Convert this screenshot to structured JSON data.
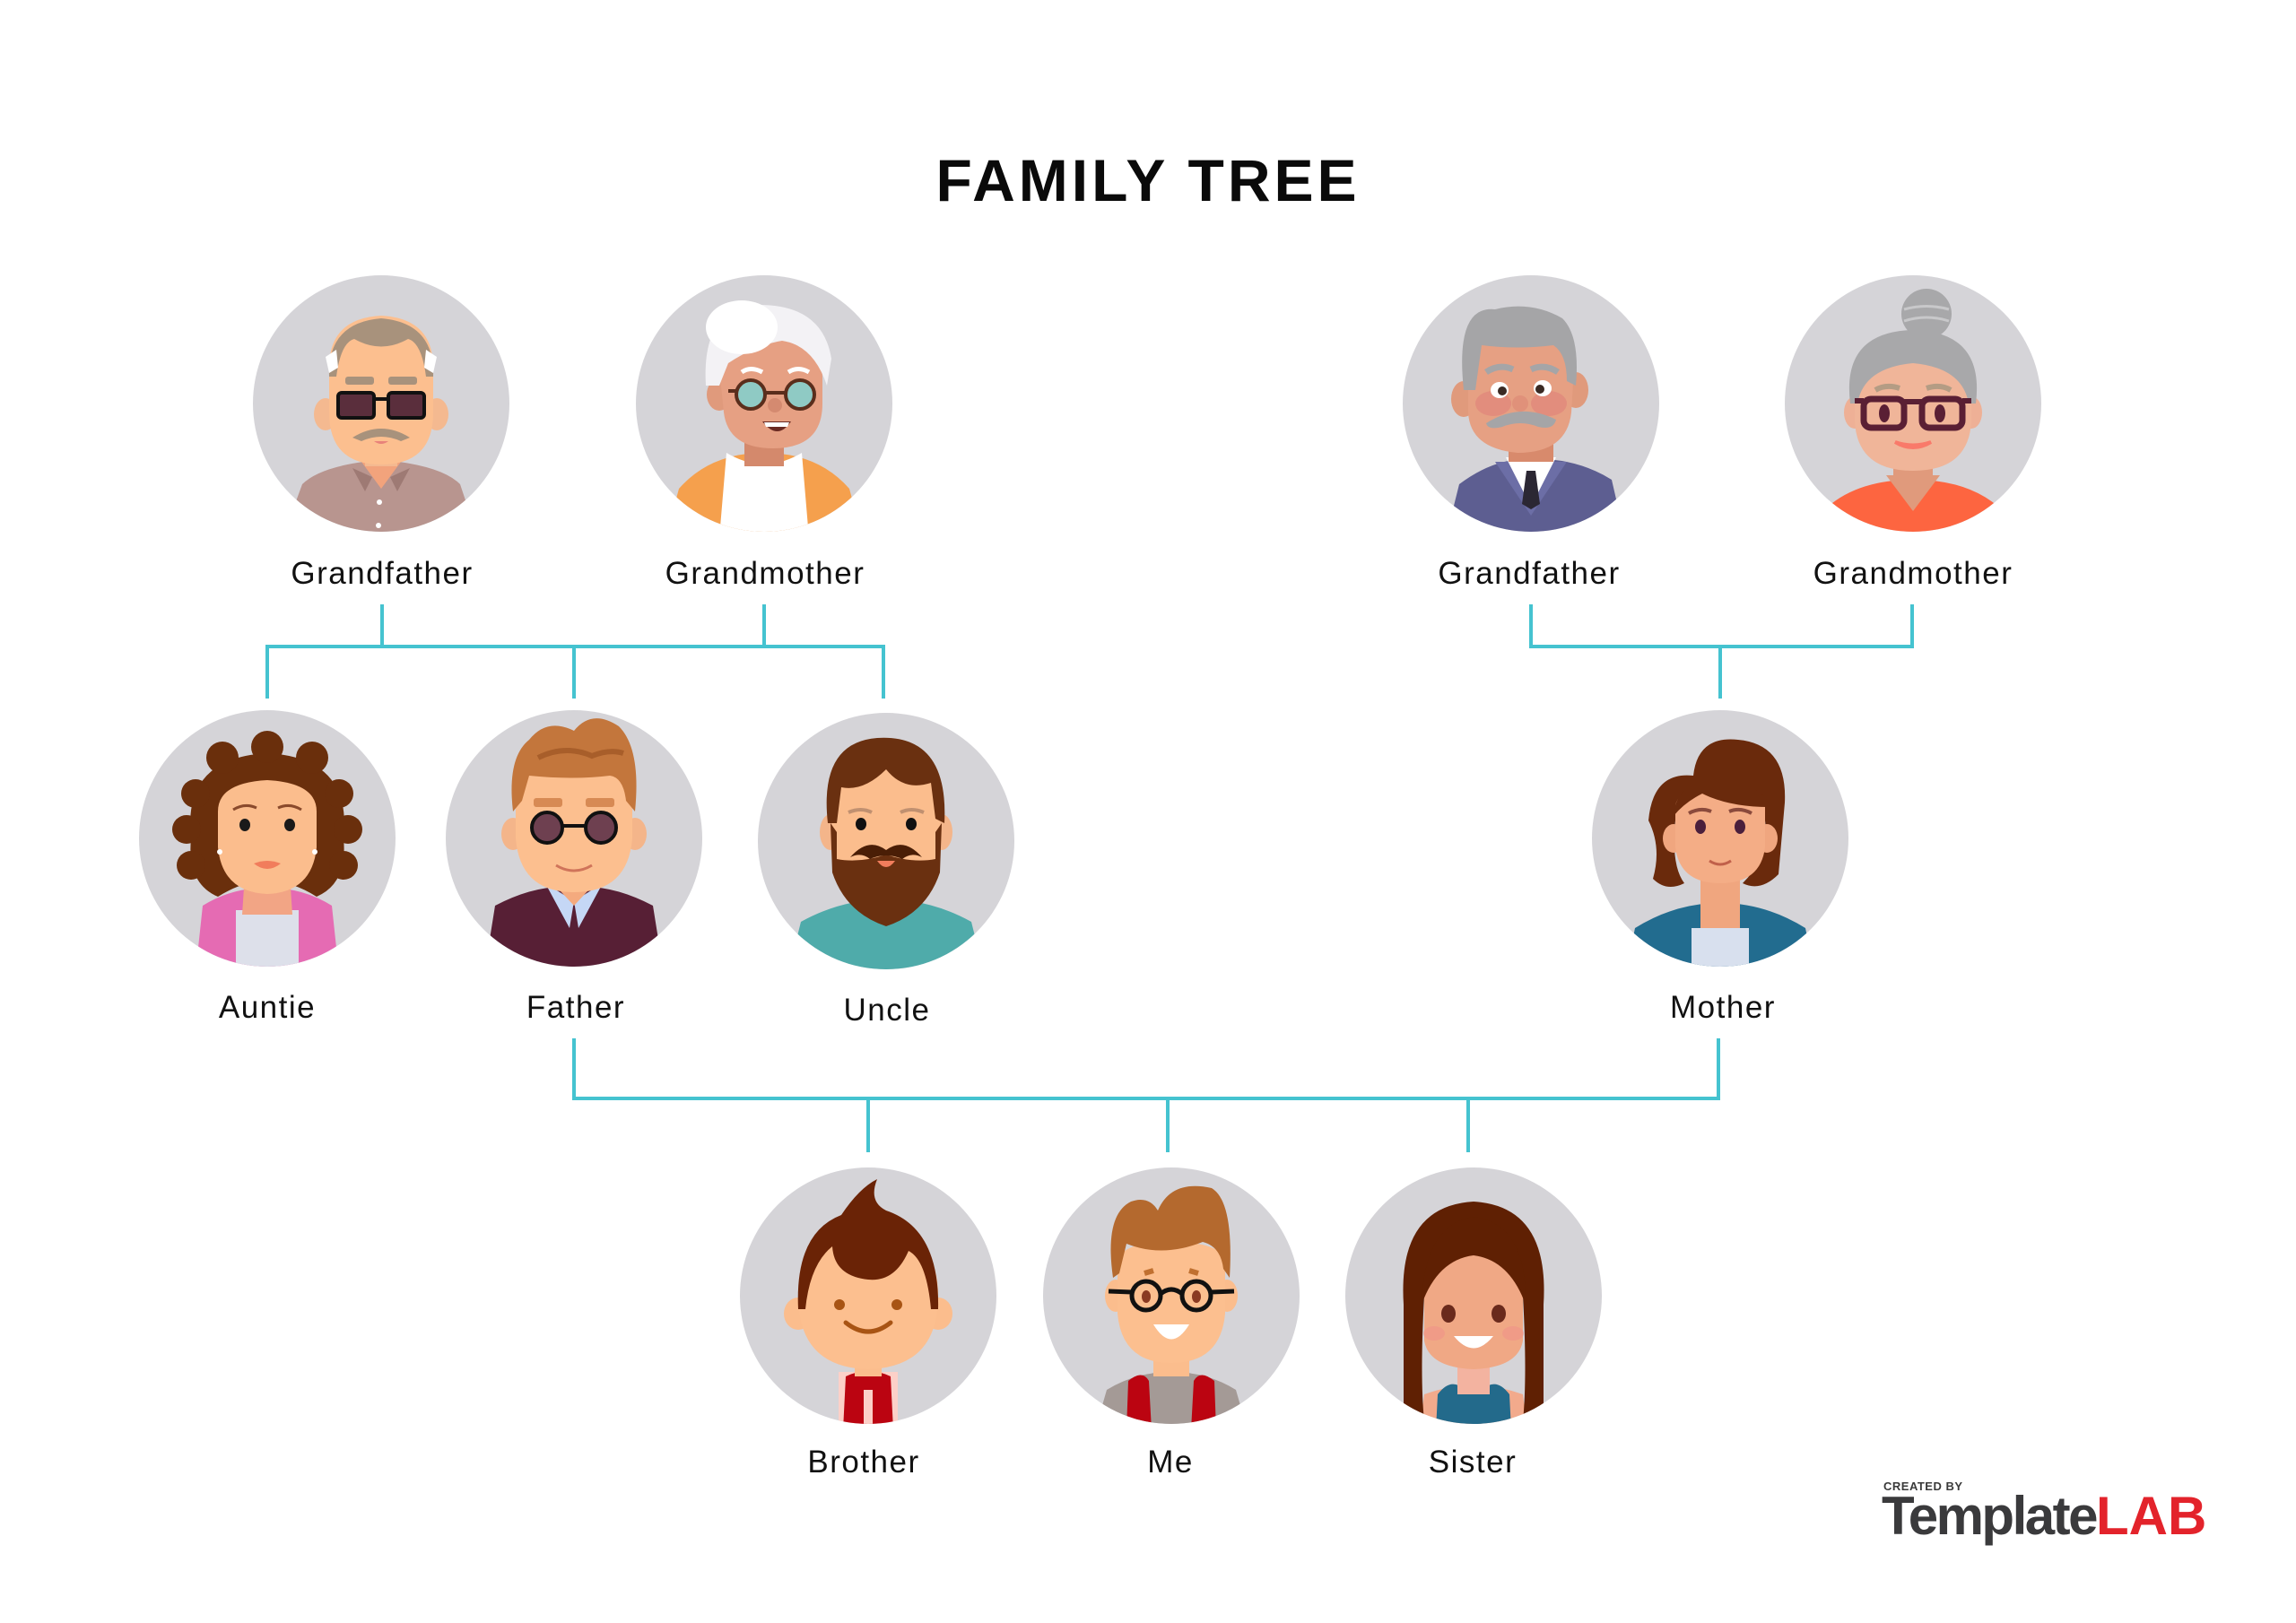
{
  "title": "FAMILY TREE",
  "colors": {
    "connector": "#45c3d0",
    "avatar_background": "#d5d4d8",
    "logo_dark": "#3a3a3c",
    "logo_accent": "#e3232b"
  },
  "members": {
    "paternal_grandfather": {
      "label": "Grandfather",
      "generation": 1,
      "side": "paternal"
    },
    "paternal_grandmother": {
      "label": "Grandmother",
      "generation": 1,
      "side": "paternal"
    },
    "maternal_grandfather": {
      "label": "Grandfather",
      "generation": 1,
      "side": "maternal"
    },
    "maternal_grandmother": {
      "label": "Grandmother",
      "generation": 1,
      "side": "maternal"
    },
    "auntie": {
      "label": "Auntie",
      "generation": 2,
      "side": "paternal"
    },
    "father": {
      "label": "Father",
      "generation": 2,
      "side": "paternal"
    },
    "uncle": {
      "label": "Uncle",
      "generation": 2,
      "side": "paternal"
    },
    "mother": {
      "label": "Mother",
      "generation": 2,
      "side": "maternal"
    },
    "brother": {
      "label": "Brother",
      "generation": 3
    },
    "me": {
      "label": "Me",
      "generation": 3
    },
    "sister": {
      "label": "Sister",
      "generation": 3
    }
  },
  "relationships": [
    {
      "parents": [
        "paternal_grandfather",
        "paternal_grandmother"
      ],
      "children": [
        "auntie",
        "father",
        "uncle"
      ]
    },
    {
      "parents": [
        "maternal_grandfather",
        "maternal_grandmother"
      ],
      "children": [
        "mother"
      ]
    },
    {
      "parents": [
        "father",
        "mother"
      ],
      "children": [
        "brother",
        "me",
        "sister"
      ]
    }
  ],
  "branding": {
    "created_by": "CREATED BY",
    "brand_part1": "Template",
    "brand_part2": "LAB"
  }
}
